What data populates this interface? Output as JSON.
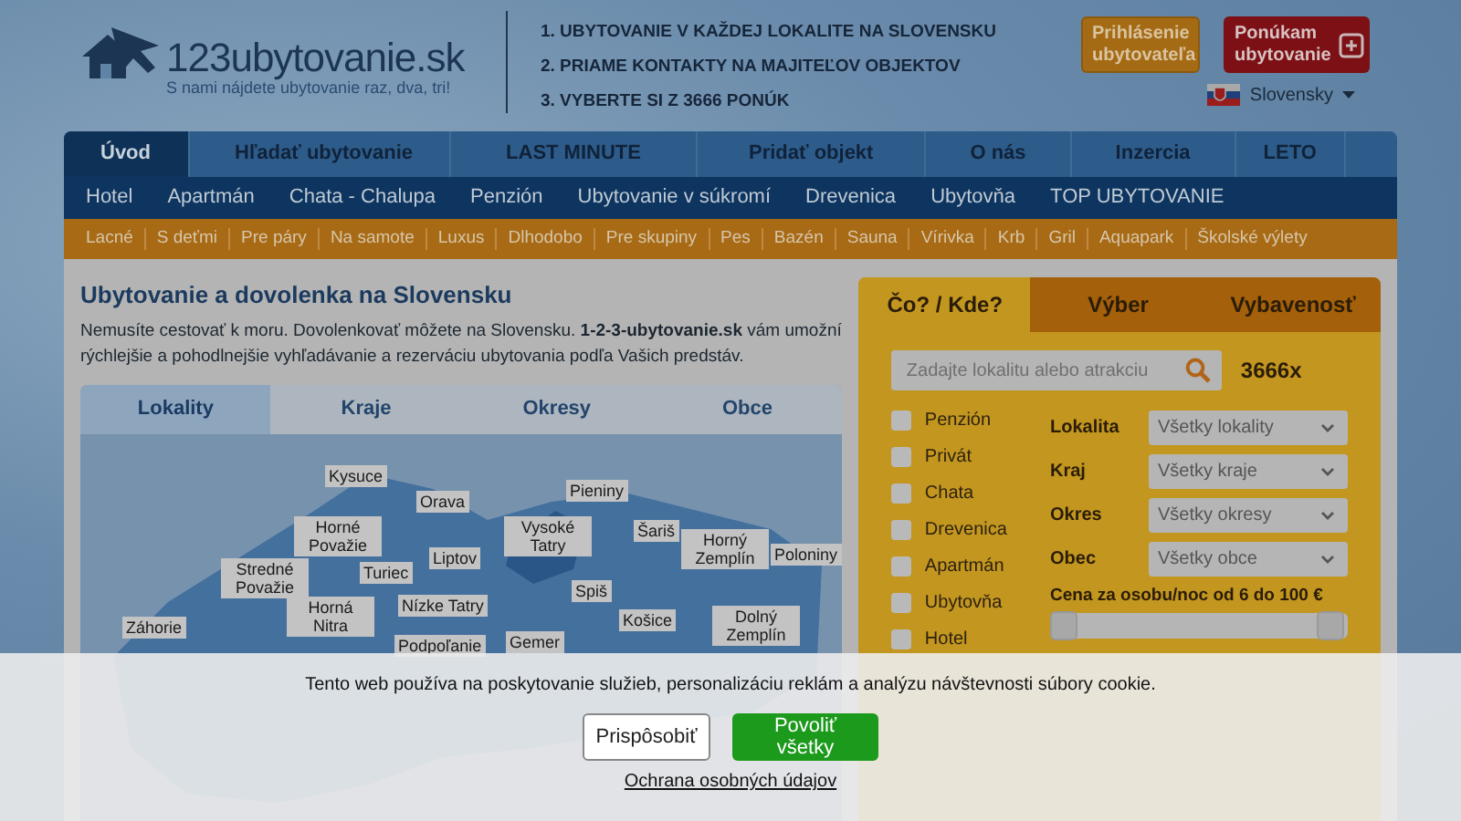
{
  "header": {
    "logo_text": "123ubytovanie.sk",
    "slogan": "S nami nájdete ubytovanie raz, dva, tri!",
    "taglines": [
      "1. UBYTOVANIE V KAŽDEJ LOKALITE NA SLOVENSKU",
      "2. PRIAME KONTAKTY NA MAJITEĽOV OBJEKTOV",
      "3. VYBERTE SI Z 3666 PONÚK"
    ],
    "login_button": "Prihlásenie ubytovateľa",
    "offer_button": "Ponúkam ubytovanie",
    "language": "Slovensky"
  },
  "main_nav": [
    {
      "label": "Úvod",
      "selected": true
    },
    {
      "label": "Hľadať ubytovanie",
      "selected": false
    },
    {
      "label": "LAST MINUTE",
      "selected": false
    },
    {
      "label": "Pridať objekt",
      "selected": false
    },
    {
      "label": "O nás",
      "selected": false
    },
    {
      "label": "Inzercia",
      "selected": false
    },
    {
      "label": "LETO",
      "selected": false
    }
  ],
  "type_nav": [
    "Hotel",
    "Apartmán",
    "Chata - Chalupa",
    "Penzión",
    "Ubytovanie v súkromí",
    "Drevenica",
    "Ubytovňa",
    "TOP UBYTOVANIE"
  ],
  "theme_nav": [
    "Lacné",
    "S deťmi",
    "Pre páry",
    "Na samote",
    "Luxus",
    "Dlhodobo",
    "Pre skupiny",
    "Pes",
    "Bazén",
    "Sauna",
    "Vírivka",
    "Krb",
    "Gril",
    "Aquapark",
    "Školské výlety"
  ],
  "intro": {
    "title": "Ubytovanie a dovolenka na Slovensku",
    "text": "Nemusíte cestovať k moru. Dovolenkovať môžete na Slovensku. **1-2-3-ubytovanie.sk** vám umožní rýchlejšie a pohodlnejšie vyhľadávanie a rezerváciu ubytovania podľa Vašich predstáv."
  },
  "map": {
    "tabs": [
      {
        "label": "Lokality",
        "selected": true
      },
      {
        "label": "Kraje",
        "selected": false
      },
      {
        "label": "Okresy",
        "selected": false
      },
      {
        "label": "Obce",
        "selected": false
      }
    ],
    "regions": [
      "Kysuce",
      "Orava",
      "Pieniny",
      "Horné Považie",
      "Vysoké Tatry",
      "Šariš",
      "Horný Zemplín",
      "Poloniny",
      "Stredné Považie",
      "Turiec",
      "Liptov",
      "Spiš",
      "Záhorie",
      "Horná Nitra",
      "Nízke Tatry",
      "Košice",
      "Dolný Zemplín",
      "Podpoľanie",
      "Gemer"
    ]
  },
  "search": {
    "tabs": [
      {
        "label": "Čo? / Kde?",
        "selected": true
      },
      {
        "label": "Výber",
        "selected": false
      },
      {
        "label": "Vybavenosť",
        "selected": false
      }
    ],
    "placeholder": "Zadajte lokalitu alebo atrakciu",
    "count": "3666x",
    "types": [
      {
        "label": "Penzión",
        "checked": false
      },
      {
        "label": "Privát",
        "checked": false
      },
      {
        "label": "Chata",
        "checked": false
      },
      {
        "label": "Drevenica",
        "checked": false
      },
      {
        "label": "Apartmán",
        "checked": false
      },
      {
        "label": "Ubytovňa",
        "checked": false
      },
      {
        "label": "Hotel",
        "checked": false
      }
    ],
    "filters": [
      {
        "label": "Lokalita",
        "value": "Všetky lokality"
      },
      {
        "label": "Kraj",
        "value": "Všetky kraje"
      },
      {
        "label": "Okres",
        "value": "Všetky okresy"
      },
      {
        "label": "Obec",
        "value": "Všetky obce"
      }
    ],
    "price_label": "Cena za osobu/noc od 6 do 100 €",
    "price_thumbs": [
      {
        "level": 0
      },
      {
        "level": 1
      }
    ]
  },
  "cookie_banner": {
    "text": "Tento web používa na poskytovanie služieb, personalizáciu reklám a analýzu návštevnosti súbory cookie.",
    "customize_button": "Prispôsobiť",
    "allow_button": "Povoliť všetky",
    "privacy_link": "Ochrana osobných údajov"
  }
}
